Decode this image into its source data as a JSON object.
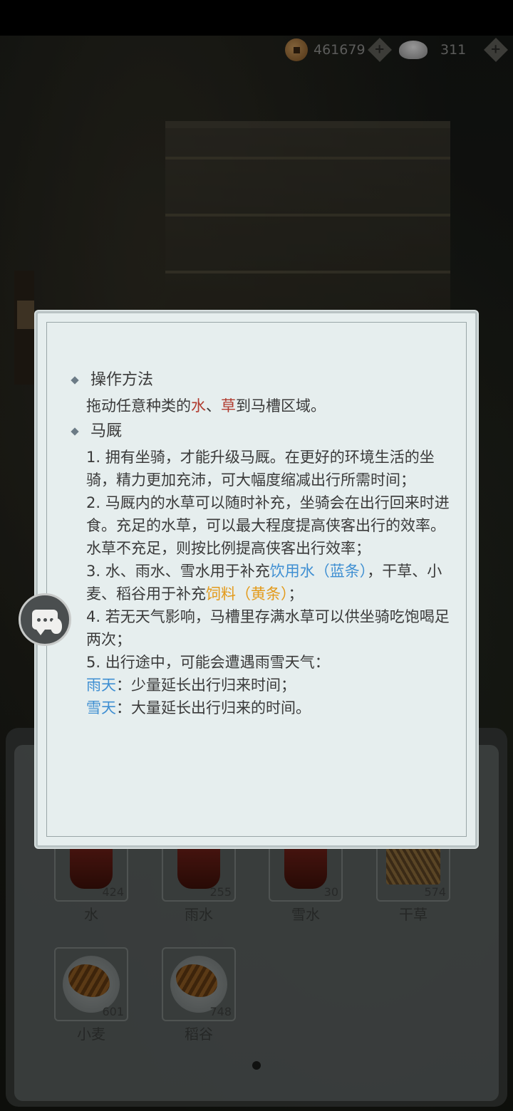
{
  "currency": {
    "coins": "461679",
    "silver": "311"
  },
  "dialog": {
    "section1": {
      "title": "操作方法",
      "line_prefix": "拖动任意种类的",
      "water": "水",
      "sep": "、",
      "grass": "草",
      "line_suffix": "到马槽区域。"
    },
    "section2": {
      "title": "马厩",
      "p1": "1. 拥有坐骑，才能升级马厩。在更好的环境生活的坐骑，精力更加充沛，可大幅度缩减出行所需时间；",
      "p2": "2. 马厩内的水草可以随时补充，坐骑会在出行回来时进食。充足的水草，可以最大程度提高侠客出行的效率。水草不充足，则按比例提高侠客出行效率；",
      "p3_a": "3. 水、雨水、雪水用于补充",
      "p3_drink": "饮用水（蓝条）",
      "p3_b": "，干草、小麦、稻谷用于补充",
      "p3_feed": "饲料（黄条）",
      "p3_c": "；",
      "p4": "4. 若无天气影响，马槽里存满水草可以供坐骑吃饱喝足两次；",
      "p5": "5. 出行途中，可能会遭遇雨雪天气：",
      "rain_label": "雨天",
      "rain_text": "：少量延长出行归来时间；",
      "snow_label": "雪天",
      "snow_text": "：大量延长出行归来的时间。"
    }
  },
  "inventory": [
    {
      "name": "水",
      "count": "424"
    },
    {
      "name": "雨水",
      "count": "255"
    },
    {
      "name": "雪水",
      "count": "30"
    },
    {
      "name": "干草",
      "count": "574"
    },
    {
      "name": "小麦",
      "count": "601"
    },
    {
      "name": "稻谷",
      "count": "748"
    }
  ],
  "colors": {
    "highlight_red": "#b03a2e",
    "highlight_blue": "#3f8fd2",
    "highlight_orange": "#e39a1a"
  }
}
